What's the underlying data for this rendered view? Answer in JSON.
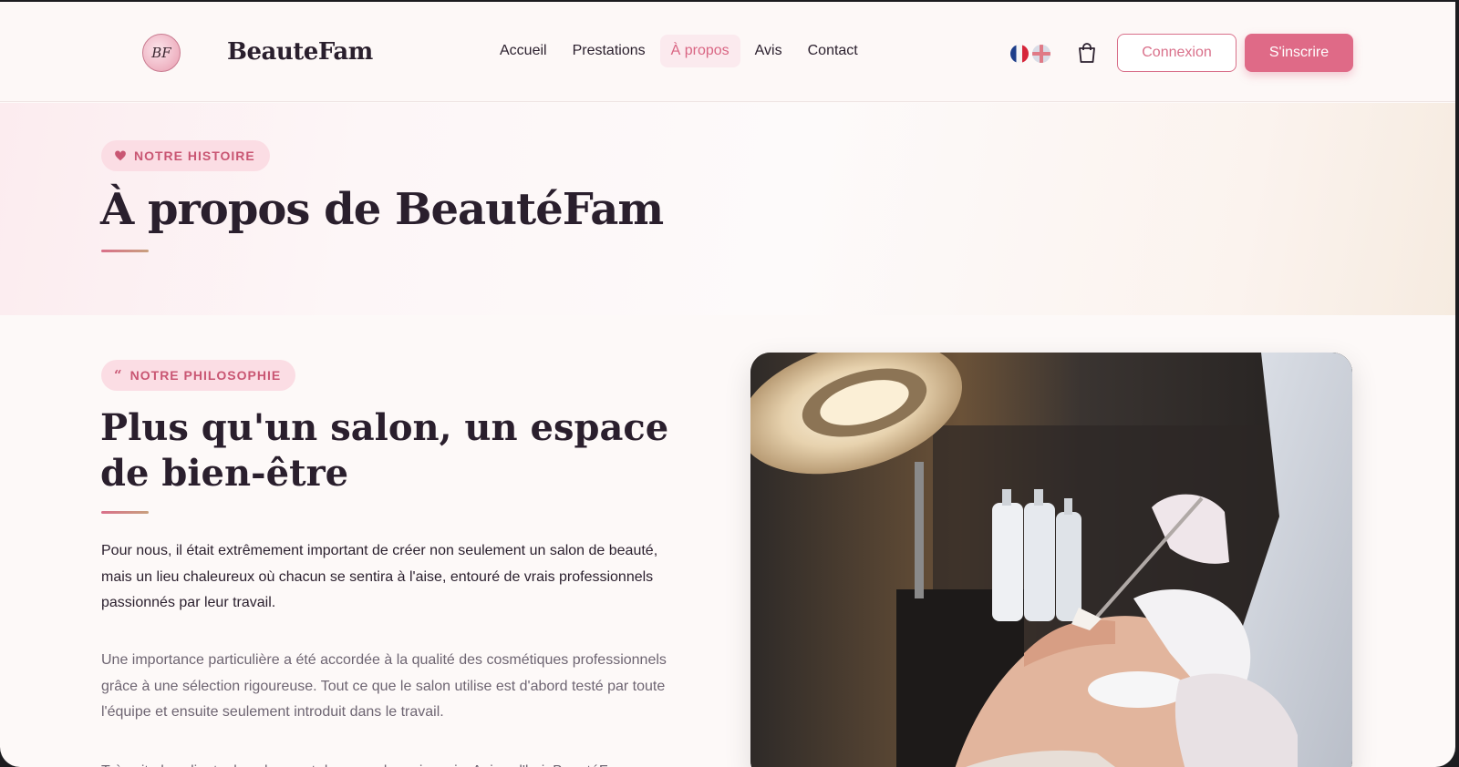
{
  "header": {
    "logo_text": "BF",
    "brand": "BeauteFam",
    "nav": [
      {
        "label": "Accueil"
      },
      {
        "label": "Prestations"
      },
      {
        "label": "À propos"
      },
      {
        "label": "Avis"
      },
      {
        "label": "Contact"
      }
    ],
    "active_nav": "À propos",
    "login_label": "Connexion",
    "signup_label": "S'inscrire"
  },
  "hero": {
    "badge": "NOTRE HISTOIRE",
    "title": "À propos de BeautéFam"
  },
  "philosophy": {
    "badge": "NOTRE PHILOSOPHIE",
    "title": "Plus qu'un salon, un espace de bien-être",
    "paragraphs": [
      "Pour nous, il était extrêmement important de créer non seulement un salon de beauté, mais un lieu chaleureux où chacun se sentira à l'aise, entouré de vrais professionnels passionnés par leur travail.",
      "Une importance particulière a été accordée à la qualité des cosmétiques professionnels grâce à une sélection rigoureuse. Tout ce que le salon utilise est d'abord testé par toute l'équipe et ensuite seulement introduit dans le travail.",
      "Très vite les clients du salon sont devenus de vrais amis. Aujourd'hui, BeautéFam"
    ]
  },
  "colors": {
    "accent": "#df6a87",
    "accent_light": "#fbdde4",
    "text_dark": "#2a1f2d",
    "text_muted": "#6e6572"
  },
  "icons": [
    "heart-icon",
    "quote-icon",
    "cart-icon",
    "flag-fr-icon",
    "flag-uk-icon"
  ]
}
